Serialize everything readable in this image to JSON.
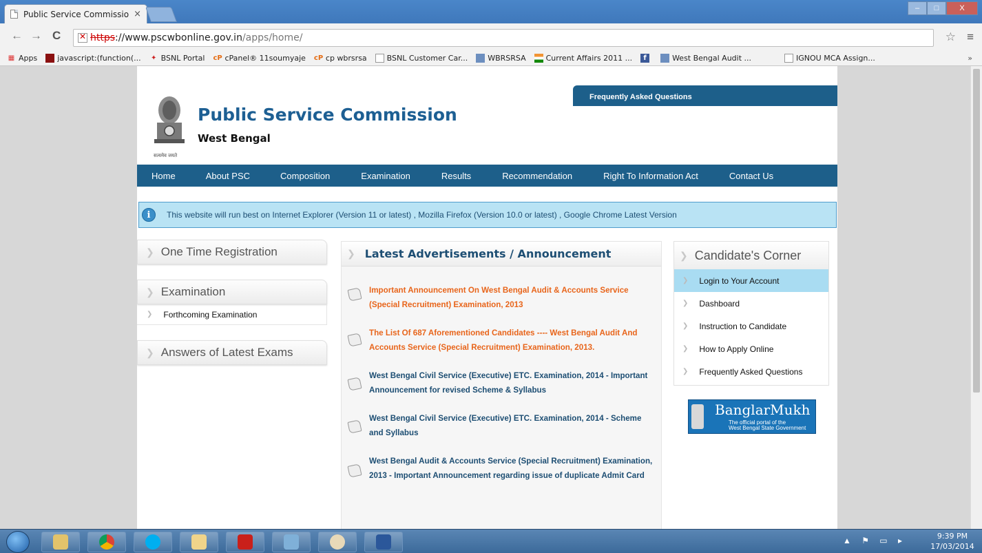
{
  "browser": {
    "tab_title": "Public Service Commissio",
    "tab_close": "×",
    "url_scheme": "https",
    "url_host": "://www.pscwbonline.gov.in",
    "url_path": "/apps/home/",
    "win_min": "‒",
    "win_max": "□",
    "win_close": "X",
    "back": "←",
    "forward": "→",
    "reload": "C",
    "bookmark_star": "☆",
    "menu_icon": "≡"
  },
  "bookmarks": [
    {
      "label": "Apps",
      "icon": "apps-grid-icon"
    },
    {
      "label": "javascript:(function(...",
      "icon": "js-icon"
    },
    {
      "label": "BSNL Portal",
      "icon": "bsnl-icon"
    },
    {
      "label": "cPanel® 11soumyaje",
      "icon": "cpanel-icon"
    },
    {
      "label": "cp wbrsrsa",
      "icon": "cpanel-icon"
    },
    {
      "label": "BSNL Customer Car...",
      "icon": "page-icon"
    },
    {
      "label": "WBRSRSA",
      "icon": "site-icon"
    },
    {
      "label": "Current Affairs 2011 ...",
      "icon": "flag-icon"
    },
    {
      "label": "",
      "icon": "facebook-icon"
    },
    {
      "label": "West Bengal Audit ...",
      "icon": "site-icon"
    },
    {
      "label": "IGNOU MCA Assign...",
      "icon": "page-icon"
    }
  ],
  "bookmarks_more": "»",
  "header": {
    "title": "Public Service Commission",
    "subtitle": "West Bengal",
    "emblem_caption": "सत्यमेव जयते",
    "faq_tab": "Frequently Asked Questions"
  },
  "nav": [
    "Home",
    "About PSC",
    "Composition",
    "Examination",
    "Results",
    "Recommendation",
    "Right To Information Act",
    "Contact Us"
  ],
  "notice": {
    "icon": "i",
    "text": "This website will run best on Internet Explorer (Version 11 or latest) , Mozilla Firefox (Version 10.0 or latest) , Google Chrome Latest Version"
  },
  "left": {
    "otr": "One Time Registration",
    "exam": "Examination",
    "forthcoming": "Forthcoming Examination",
    "answers": "Answers of Latest Exams"
  },
  "center": {
    "heading": "Latest Advertisements / Announcement",
    "items": [
      {
        "text": "Important Announcement On West Bengal Audit & Accounts Service (Special Recruitment) Examination, 2013",
        "color": "orange"
      },
      {
        "text": "The List Of 687 Aforementioned Candidates ---- West Bengal Audit And Accounts Service (Special Recruitment) Examination, 2013.",
        "color": "orange"
      },
      {
        "text": "West Bengal Civil Service (Executive) ETC. Examination, 2014 - Important Announcement for revised Scheme & Syllabus",
        "color": "blue"
      },
      {
        "text": "West Bengal Civil Service (Executive) ETC. Examination, 2014 - Scheme and Syllabus",
        "color": "blue"
      },
      {
        "text": "West Bengal Audit & Accounts Service (Special Recruitment) Examination, 2013 - Important Announcement regarding issue of duplicate Admit Card",
        "color": "blue"
      }
    ]
  },
  "right": {
    "heading": "Candidate's Corner",
    "items": [
      "Login to Your Account",
      "Dashboard",
      "Instruction to Candidate",
      "How to Apply Online",
      "Frequently Asked Questions"
    ]
  },
  "banglar": {
    "title": "BanglarMukh",
    "sub1": "The official portal of  the",
    "sub2": "West Bengal State Government"
  },
  "taskbar": {
    "time": "9:39 PM",
    "date": "17/03/2014",
    "tray": "▲ ⚑ ▭ ▸"
  },
  "colors": {
    "brand_blue": "#1d5f8a",
    "announcement_orange": "#e8651b",
    "active_item": "#a9dcf2"
  }
}
